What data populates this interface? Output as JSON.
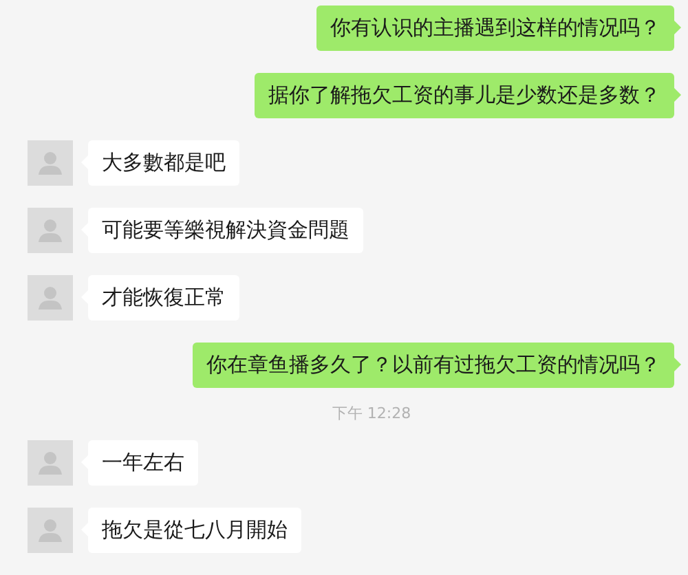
{
  "messages": [
    {
      "kind": "sent",
      "text": "你有认识的主播遇到这样的情况吗？"
    },
    {
      "kind": "sent",
      "text": "据你了解拖欠工资的事儿是少数还是多数？"
    },
    {
      "kind": "received",
      "text": "大多數都是吧"
    },
    {
      "kind": "received",
      "text": "可能要等樂視解決資金問題"
    },
    {
      "kind": "received",
      "text": "才能恢復正常"
    },
    {
      "kind": "sent",
      "text": "你在章鱼播多久了？以前有过拖欠工资的情况吗？"
    },
    {
      "kind": "time",
      "text": "下午 12:28"
    },
    {
      "kind": "received",
      "text": "一年左右"
    },
    {
      "kind": "received",
      "text": "拖欠是從七八月開始"
    }
  ]
}
